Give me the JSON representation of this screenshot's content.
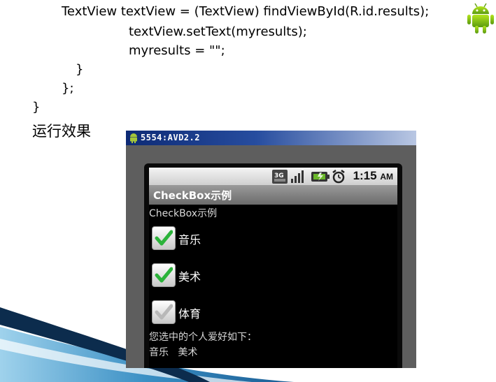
{
  "code": {
    "line1": "TextView textView = (TextView) findViewById(R.id.results);",
    "line2": "textView.setText(myresults);",
    "line3": "myresults = \"\";",
    "line4": "}",
    "line5": "};",
    "line6": "}"
  },
  "heading": "运行效果",
  "emulator": {
    "title": "5554:AVD2.2",
    "status": {
      "time": "1:15",
      "ampm": "AM",
      "network": "3G"
    },
    "app_title": "CheckBox示例",
    "prompt": "CheckBox示例",
    "checkboxes": [
      {
        "label": "音乐",
        "checked": true
      },
      {
        "label": "美术",
        "checked": true
      },
      {
        "label": "体育",
        "checked": false
      }
    ],
    "result_label": "您选中的个人爱好如下：",
    "result_value": "音乐   美术"
  },
  "colors": {
    "check_green": "#2bb33a",
    "title_bar_blue": "#0d2a75",
    "swoosh_blue": "#3a8fc4"
  },
  "icons": [
    "android-logo-icon",
    "signal-icon",
    "battery-icon",
    "alarm-icon",
    "checkmark-icon"
  ]
}
